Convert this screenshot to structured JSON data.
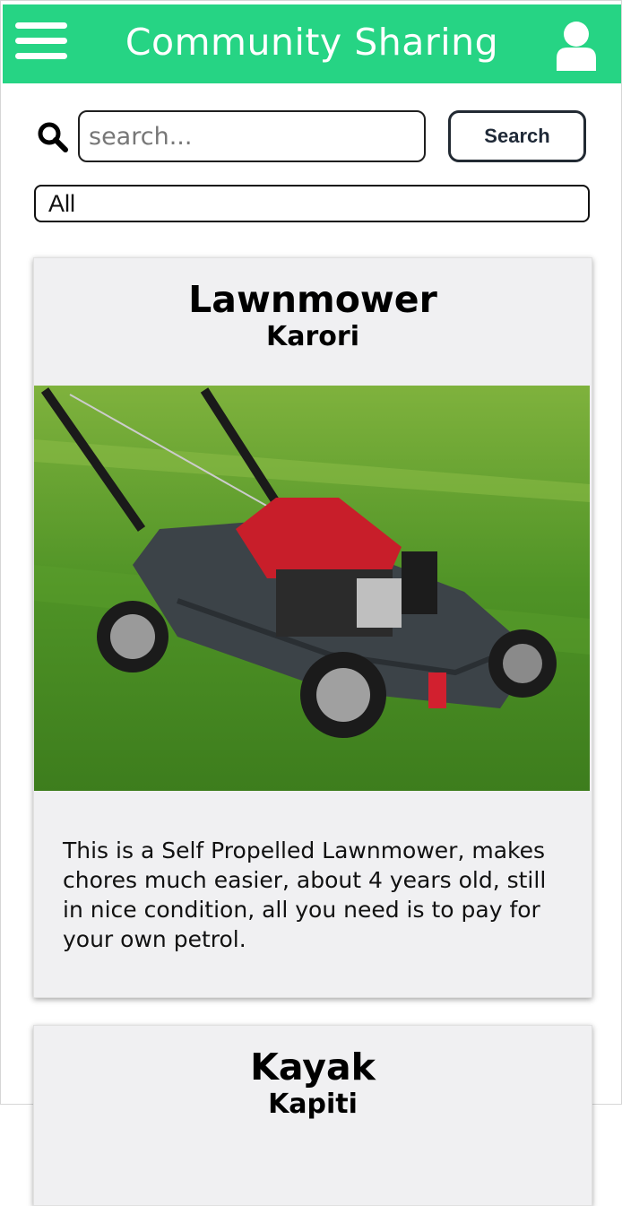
{
  "header": {
    "title": "Community Sharing",
    "menu_icon": "hamburger-menu-icon",
    "user_icon": "user-icon",
    "background_color": "#26d484"
  },
  "search": {
    "icon": "search-icon",
    "placeholder": "search...",
    "value": "",
    "button_label": "Search"
  },
  "filter": {
    "selected": "All"
  },
  "listings": [
    {
      "title": "Lawnmower",
      "location": "Karori",
      "image": "lawnmower-photo",
      "description": "This is a Self Propelled Lawnmower, makes chores much easier, about 4 years old, still in nice condition, all you need is to pay for your own petrol."
    },
    {
      "title": "Kayak",
      "location": "Kapiti"
    }
  ]
}
